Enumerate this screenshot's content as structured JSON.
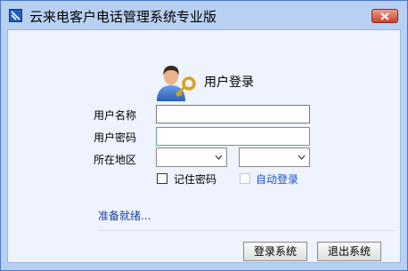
{
  "window": {
    "title": "云来电客户电话管理系统专业版",
    "icon": "app-icon"
  },
  "login": {
    "heading": "用户登录",
    "icon": "user-key-icon",
    "username_label": "用户名称",
    "username_value": "",
    "password_label": "用户密码",
    "password_value": "",
    "region_label": "所在地区",
    "region_select_1": "",
    "region_select_2": "",
    "remember_label": "记住密码",
    "remember_checked": false,
    "auto_login_label": "自动登录",
    "auto_login_checked": false,
    "auto_login_enabled": false
  },
  "status": {
    "text": "准备就绪..."
  },
  "buttons": {
    "login": "登录系统",
    "exit": "退出系统"
  }
}
